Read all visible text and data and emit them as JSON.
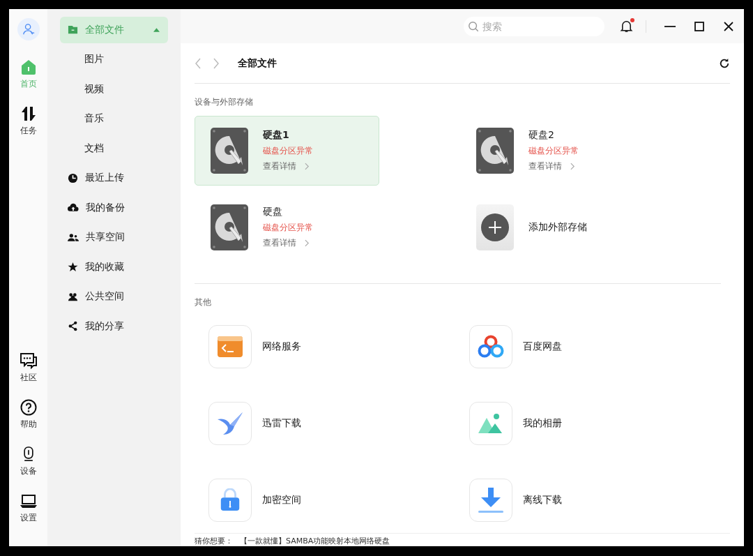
{
  "rail": {
    "top": [
      {
        "label": "首页",
        "selected": true
      },
      {
        "label": "任务",
        "selected": false
      }
    ],
    "bottom": [
      {
        "label": "社区"
      },
      {
        "label": "帮助"
      },
      {
        "label": "设备"
      },
      {
        "label": "设置"
      }
    ]
  },
  "sidebar": {
    "items": [
      {
        "label": "全部文件",
        "selected": true,
        "expanded": true,
        "children": [
          {
            "label": "图片"
          },
          {
            "label": "视频"
          },
          {
            "label": "音乐"
          },
          {
            "label": "文档"
          }
        ]
      },
      {
        "label": "最近上传",
        "selected": false
      },
      {
        "label": "我的备份",
        "selected": false
      },
      {
        "label": "共享空间",
        "selected": false
      },
      {
        "label": "我的收藏",
        "selected": false
      },
      {
        "label": "公共空间",
        "selected": false
      },
      {
        "label": "我的分享",
        "selected": false
      }
    ]
  },
  "topbar": {
    "search": {
      "placeholder": "搜索"
    },
    "notification_unread": true
  },
  "breadcrumb": {
    "title": "全部文件"
  },
  "sections": [
    {
      "title": "设备与外部存储",
      "items": [
        {
          "kind": "disk",
          "name": "硬盘1",
          "status": "磁盘分区异常",
          "link": "查看详情",
          "selected": true
        },
        {
          "kind": "disk",
          "name": "硬盘2",
          "status": "磁盘分区异常",
          "link": "查看详情",
          "selected": false
        },
        {
          "kind": "disk",
          "name": "硬盘",
          "status": "磁盘分区异常",
          "link": "查看详情",
          "selected": false
        },
        {
          "kind": "add",
          "name": "添加外部存储",
          "selected": false
        }
      ]
    },
    {
      "title": "其他",
      "items": [
        {
          "kind": "app",
          "name": "网络服务"
        },
        {
          "kind": "app",
          "name": "百度网盘"
        },
        {
          "kind": "app",
          "name": "迅雷下载"
        },
        {
          "kind": "app",
          "name": "我的相册"
        },
        {
          "kind": "app",
          "name": "加密空间"
        },
        {
          "kind": "app",
          "name": "离线下载"
        }
      ]
    }
  ],
  "footer": {
    "label": "猜你想要：",
    "link": "【一款就懂】SAMBA功能映射本地网络硬盘"
  }
}
